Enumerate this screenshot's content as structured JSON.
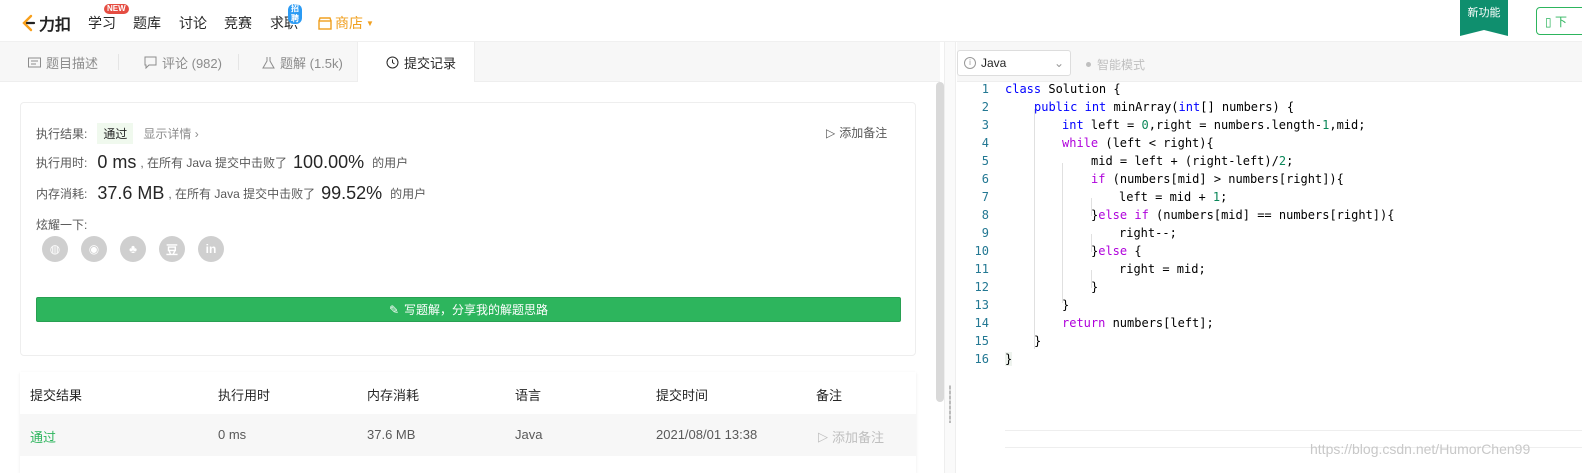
{
  "nav": {
    "logo": "力扣",
    "items": [
      {
        "label": "学习",
        "badge": "NEW"
      },
      {
        "label": "题库"
      },
      {
        "label": "讨论"
      },
      {
        "label": "竞赛"
      },
      {
        "label": "求职",
        "badge": "招聘"
      },
      {
        "label": "商店"
      }
    ],
    "new_feature": "新功能",
    "right_button": "下"
  },
  "tabs": [
    {
      "label": "题目描述",
      "icon": "description-icon"
    },
    {
      "label": "评论 (982)",
      "icon": "comment-icon"
    },
    {
      "label": "题解 (1.5k)",
      "icon": "flask-icon"
    },
    {
      "label": "提交记录",
      "icon": "clock-icon"
    }
  ],
  "result": {
    "result_label": "执行结果:",
    "status": "通过",
    "detail_link": "显示详情 ›",
    "add_note": "添加备注",
    "time_label": "执行用时:",
    "time_value": "0 ms",
    "time_desc": ", 在所有 Java 提交中击败了",
    "time_pct": "100.00%",
    "users": "的用户",
    "mem_label": "内存消耗:",
    "mem_value": "37.6 MB",
    "mem_desc": ", 在所有 Java 提交中击败了",
    "mem_pct": "99.52%",
    "share_label": "炫耀一下:",
    "share_icons": [
      "wechat-icon",
      "weibo-icon",
      "qq-icon",
      "douban-icon",
      "linkedin-icon"
    ],
    "write_button": "写题解，分享我的解题思路"
  },
  "table": {
    "headers": [
      "提交结果",
      "执行用时",
      "内存消耗",
      "语言",
      "提交时间",
      "备注"
    ],
    "rows": [
      {
        "result": "通过",
        "time": "0 ms",
        "memory": "37.6 MB",
        "language": "Java",
        "submitted": "2021/08/01 13:38",
        "note": "添加备注"
      }
    ]
  },
  "editor": {
    "language": "Java",
    "smart_mode": "智能模式",
    "lines": [
      "1",
      "2",
      "3",
      "4",
      "5",
      "6",
      "7",
      "8",
      "9",
      "10",
      "11",
      "12",
      "13",
      "14",
      "15",
      "16"
    ],
    "code": {
      "l1a": "class",
      "l1b": " Solution {",
      "l2a": "public",
      "l2b": "int",
      "l2c": " minArray(",
      "l2d": "int",
      "l2e": "[] numbers) {",
      "l3a": "int",
      "l3b": " left = ",
      "l3c": "0",
      "l3d": ",right = numbers.length-",
      "l3e": "1",
      "l3f": ",mid;",
      "l4a": "while",
      "l4b": " (left < right){",
      "l5a": "mid = left + (right-left)/",
      "l5b": "2",
      "l5c": ";",
      "l6a": "if",
      "l6b": " (numbers[mid] > numbers[right]){",
      "l7a": "left = mid + ",
      "l7b": "1",
      "l7c": ";",
      "l8a": "}",
      "l8b": "else",
      "l8c": " ",
      "l8d": "if",
      "l8e": " (numbers[mid] == numbers[right]){",
      "l9": "right--;",
      "l10a": "}",
      "l10b": "else",
      "l10c": " {",
      "l11": "right = mid;",
      "l12": "}",
      "l13": "}",
      "l14a": "return",
      "l14b": " numbers[left];",
      "l15": "}",
      "l16": "}"
    }
  },
  "watermark": "https://blog.csdn.net/HumorChen99"
}
